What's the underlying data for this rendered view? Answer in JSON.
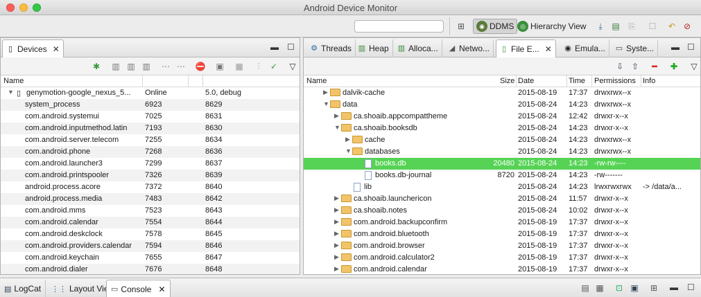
{
  "window": {
    "title": "Android Device Monitor"
  },
  "toolbar": {
    "search_value": "",
    "perspectives": [
      {
        "label": "DDMS",
        "icon": "ddms-icon",
        "active": true
      },
      {
        "label": "Hierarchy View",
        "icon": "hierarchy-view-icon",
        "active": false
      }
    ]
  },
  "devices_panel": {
    "tab_label": "Devices",
    "columns": [
      "Name",
      "",
      "",
      ""
    ],
    "device": {
      "name": "genymotion-google_nexus_5...",
      "status": "Online",
      "version": "5.0, debug"
    },
    "processes": [
      {
        "name": "system_process",
        "pid": "6923",
        "port": "8629"
      },
      {
        "name": "com.android.systemui",
        "pid": "7025",
        "port": "8631"
      },
      {
        "name": "com.android.inputmethod.latin",
        "pid": "7193",
        "port": "8630"
      },
      {
        "name": "com.android.server.telecom",
        "pid": "7255",
        "port": "8634"
      },
      {
        "name": "com.android.phone",
        "pid": "7268",
        "port": "8636"
      },
      {
        "name": "com.android.launcher3",
        "pid": "7299",
        "port": "8637"
      },
      {
        "name": "com.android.printspooler",
        "pid": "7326",
        "port": "8639"
      },
      {
        "name": "android.process.acore",
        "pid": "7372",
        "port": "8640"
      },
      {
        "name": "android.process.media",
        "pid": "7483",
        "port": "8642"
      },
      {
        "name": "com.android.mms",
        "pid": "7523",
        "port": "8643"
      },
      {
        "name": "com.android.calendar",
        "pid": "7554",
        "port": "8644"
      },
      {
        "name": "com.android.deskclock",
        "pid": "7578",
        "port": "8645"
      },
      {
        "name": "com.android.providers.calendar",
        "pid": "7594",
        "port": "8646"
      },
      {
        "name": "com.android.keychain",
        "pid": "7655",
        "port": "8647"
      },
      {
        "name": "com.android.dialer",
        "pid": "7676",
        "port": "8648"
      }
    ]
  },
  "right_tabs": [
    {
      "label": "Threads",
      "icon": "threads-icon"
    },
    {
      "label": "Heap",
      "icon": "heap-icon"
    },
    {
      "label": "Alloca...",
      "icon": "allocation-tracker-icon"
    },
    {
      "label": "Netwo...",
      "icon": "network-statistics-icon"
    },
    {
      "label": "File E...",
      "icon": "file-explorer-icon",
      "active": true
    },
    {
      "label": "Emula...",
      "icon": "emulator-control-icon"
    },
    {
      "label": "Syste...",
      "icon": "system-information-icon"
    }
  ],
  "file_explorer": {
    "columns": {
      "name": "Name",
      "size": "Size",
      "date": "Date",
      "time": "Time",
      "permissions": "Permissions",
      "info": "Info"
    },
    "rows": [
      {
        "name": "dalvik-cache",
        "size": "",
        "date": "2015-08-19",
        "time": "17:37",
        "perm": "drwxrwx--x",
        "info": "",
        "type": "folder",
        "depth": 0,
        "expanded": false
      },
      {
        "name": "data",
        "size": "",
        "date": "2015-08-24",
        "time": "14:23",
        "perm": "drwxrwx--x",
        "info": "",
        "type": "folder",
        "depth": 0,
        "expanded": true
      },
      {
        "name": "ca.shoaib.appcompattheme",
        "size": "",
        "date": "2015-08-24",
        "time": "12:42",
        "perm": "drwxr-x--x",
        "info": "",
        "type": "folder",
        "depth": 1,
        "expanded": false
      },
      {
        "name": "ca.shoaib.booksdb",
        "size": "",
        "date": "2015-08-24",
        "time": "14:23",
        "perm": "drwxr-x--x",
        "info": "",
        "type": "folder",
        "depth": 1,
        "expanded": true
      },
      {
        "name": "cache",
        "size": "",
        "date": "2015-08-24",
        "time": "14:23",
        "perm": "drwxrwx--x",
        "info": "",
        "type": "folder",
        "depth": 2,
        "expanded": false
      },
      {
        "name": "databases",
        "size": "",
        "date": "2015-08-24",
        "time": "14:23",
        "perm": "drwxrwx--x",
        "info": "",
        "type": "folder",
        "depth": 2,
        "expanded": true
      },
      {
        "name": "books.db",
        "size": "20480",
        "date": "2015-08-24",
        "time": "14:23",
        "perm": "-rw-rw----",
        "info": "",
        "type": "file",
        "depth": 3,
        "selected": true
      },
      {
        "name": "books.db-journal",
        "size": "8720",
        "date": "2015-08-24",
        "time": "14:23",
        "perm": "-rw-------",
        "info": "",
        "type": "file",
        "depth": 3
      },
      {
        "name": "lib",
        "size": "",
        "date": "2015-08-24",
        "time": "14:23",
        "perm": "lrwxrwxrwx",
        "info": "-> /data/a...",
        "type": "file",
        "depth": 2
      },
      {
        "name": "ca.shoaib.launchericon",
        "size": "",
        "date": "2015-08-24",
        "time": "11:57",
        "perm": "drwxr-x--x",
        "info": "",
        "type": "folder",
        "depth": 1,
        "expanded": false
      },
      {
        "name": "ca.shoaib.notes",
        "size": "",
        "date": "2015-08-24",
        "time": "10:02",
        "perm": "drwxr-x--x",
        "info": "",
        "type": "folder",
        "depth": 1,
        "expanded": false
      },
      {
        "name": "com.android.backupconfirm",
        "size": "",
        "date": "2015-08-19",
        "time": "17:37",
        "perm": "drwxr-x--x",
        "info": "",
        "type": "folder",
        "depth": 1,
        "expanded": false
      },
      {
        "name": "com.android.bluetooth",
        "size": "",
        "date": "2015-08-19",
        "time": "17:37",
        "perm": "drwxr-x--x",
        "info": "",
        "type": "folder",
        "depth": 1,
        "expanded": false
      },
      {
        "name": "com.android.browser",
        "size": "",
        "date": "2015-08-19",
        "time": "17:37",
        "perm": "drwxr-x--x",
        "info": "",
        "type": "folder",
        "depth": 1,
        "expanded": false
      },
      {
        "name": "com.android.calculator2",
        "size": "",
        "date": "2015-08-19",
        "time": "17:37",
        "perm": "drwxr-x--x",
        "info": "",
        "type": "folder",
        "depth": 1,
        "expanded": false
      },
      {
        "name": "com.android.calendar",
        "size": "",
        "date": "2015-08-19",
        "time": "17:37",
        "perm": "drwxr-x--x",
        "info": "",
        "type": "folder",
        "depth": 1,
        "expanded": false
      }
    ]
  },
  "bottom_tabs": [
    {
      "label": "LogCat",
      "icon": "logcat-icon"
    },
    {
      "label": "Layout View",
      "icon": "layout-view-icon"
    },
    {
      "label": "Console",
      "icon": "console-icon",
      "active": true
    }
  ],
  "colors": {
    "selection": "#56d355",
    "folder": "#f2c46a"
  }
}
